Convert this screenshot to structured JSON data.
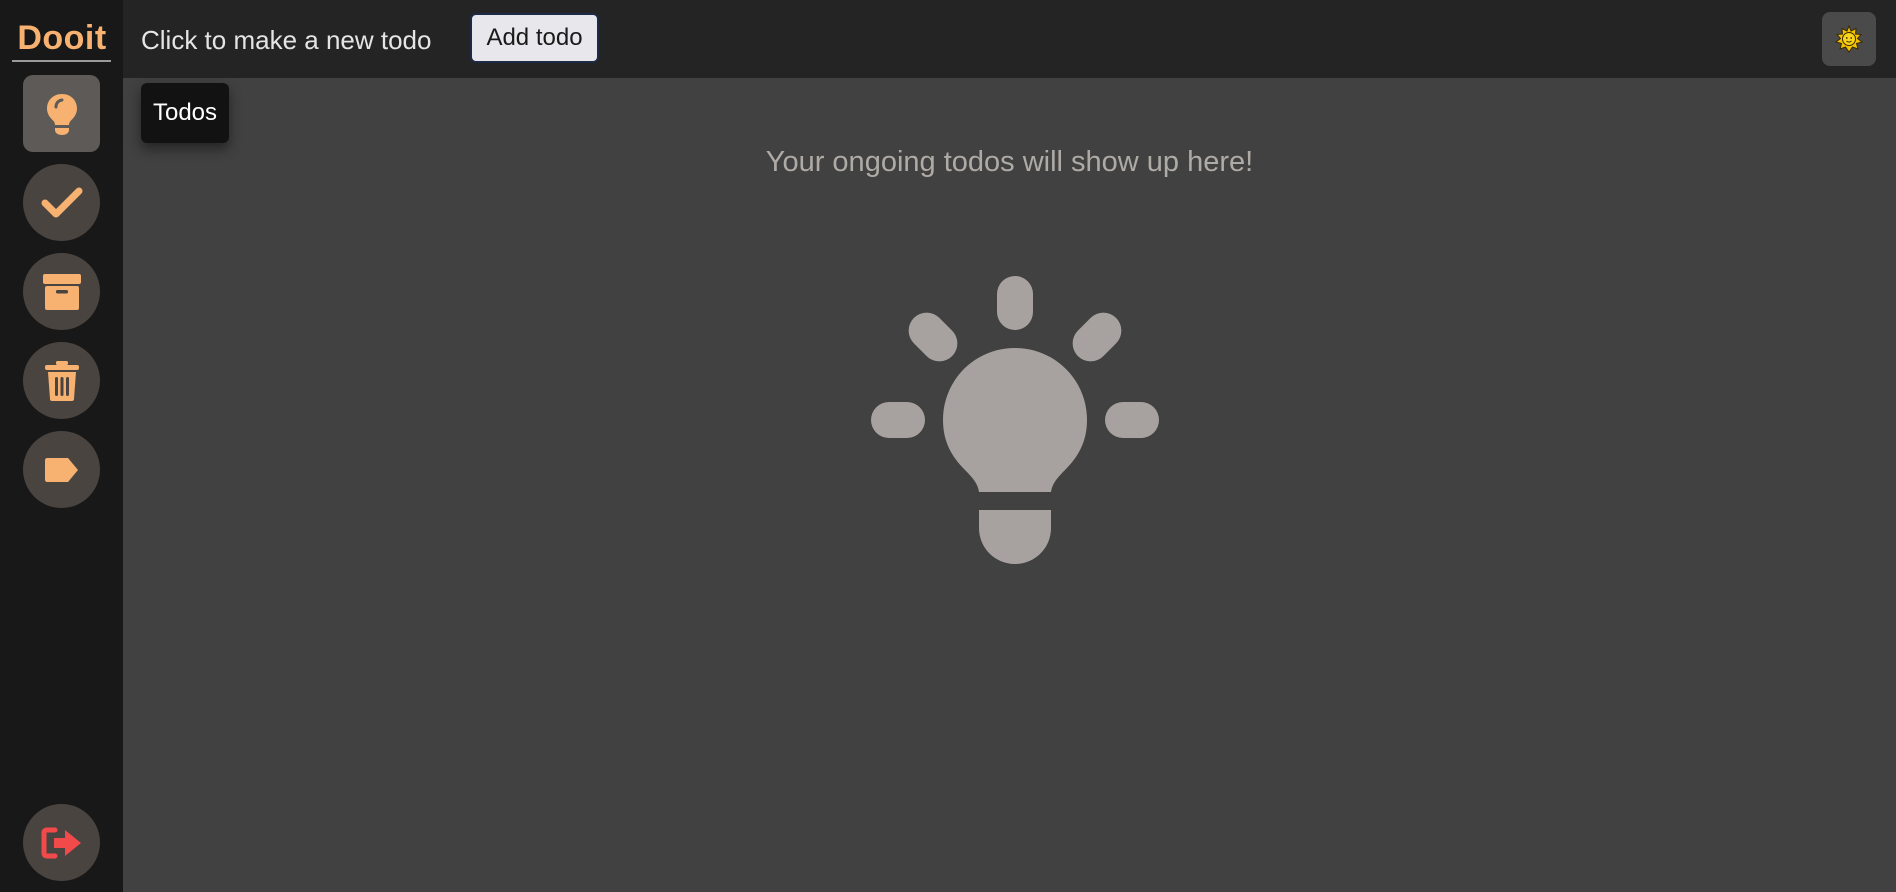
{
  "app": {
    "logo": "Dooit",
    "brand_color": "#f7b170",
    "accent_red": "#f24a4a"
  },
  "sidebar": {
    "items": [
      {
        "label": "Todos",
        "icon": "lightbulb-icon",
        "active": true
      },
      {
        "label": "",
        "icon": "checkmark-icon",
        "active": false
      },
      {
        "label": "",
        "icon": "archive-box-icon",
        "active": false
      },
      {
        "label": "",
        "icon": "trash-icon",
        "active": false
      },
      {
        "label": "",
        "icon": "tag-icon",
        "active": false
      }
    ],
    "logout_icon": "logout-icon"
  },
  "header": {
    "prompt": "Click to make a new todo",
    "add_button_label": "Add todo",
    "theme_toggle_icon": "sun-icon"
  },
  "tooltip": {
    "text": "Todos"
  },
  "main": {
    "empty_message": "Your ongoing todos will show up here!",
    "empty_icon": "lightbulb-icon"
  }
}
